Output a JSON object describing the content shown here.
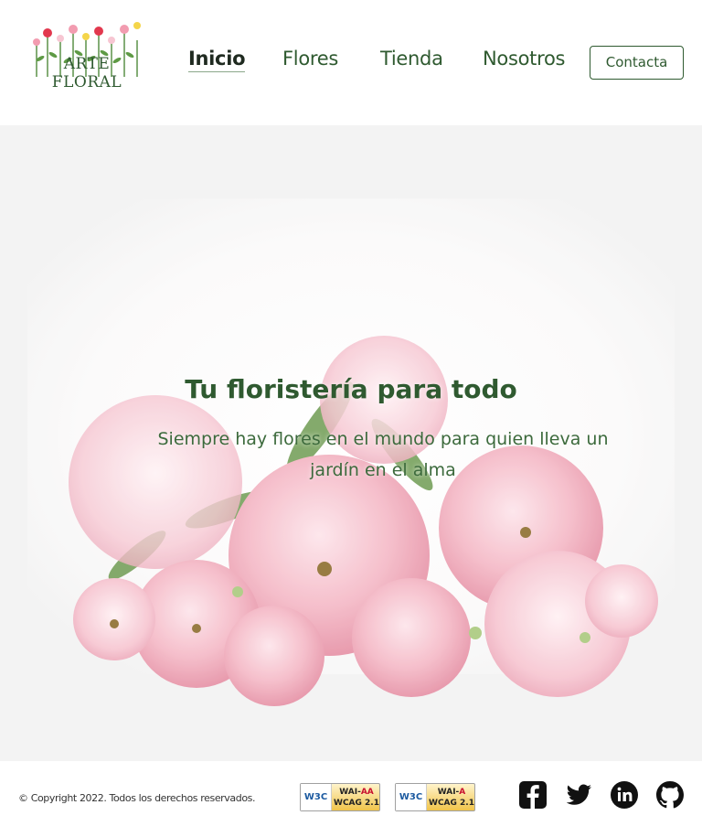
{
  "brand": {
    "logo_text": "ARTE FLORAL"
  },
  "nav": {
    "items": [
      {
        "label": "Inicio",
        "active": true
      },
      {
        "label": "Flores"
      },
      {
        "label": "Tienda"
      },
      {
        "label": "Nosotros"
      }
    ],
    "contact_label": "Contacta"
  },
  "hero": {
    "title": "Tu floristería para todo",
    "subtitle": "Siempre hay flores en el mundo para quien lleva un jardín en el alma"
  },
  "footer": {
    "copyright": "© Copyright 2022. Todos los derechos reservados.",
    "badges": [
      {
        "w3c": "W3C",
        "line1_prefix": "WAI-",
        "level": "AA",
        "line2": "WCAG 2.1"
      },
      {
        "w3c": "W3C",
        "line1_prefix": "WAI-",
        "level": "A",
        "line2": "WCAG 2.1"
      }
    ],
    "social_icons": [
      "facebook-icon",
      "twitter-icon",
      "linkedin-icon",
      "github-icon"
    ]
  },
  "colors": {
    "brand_green": "#2f5a30",
    "hero_bg": "#f2f2f2",
    "petal_pink": "#f4b6c4"
  }
}
